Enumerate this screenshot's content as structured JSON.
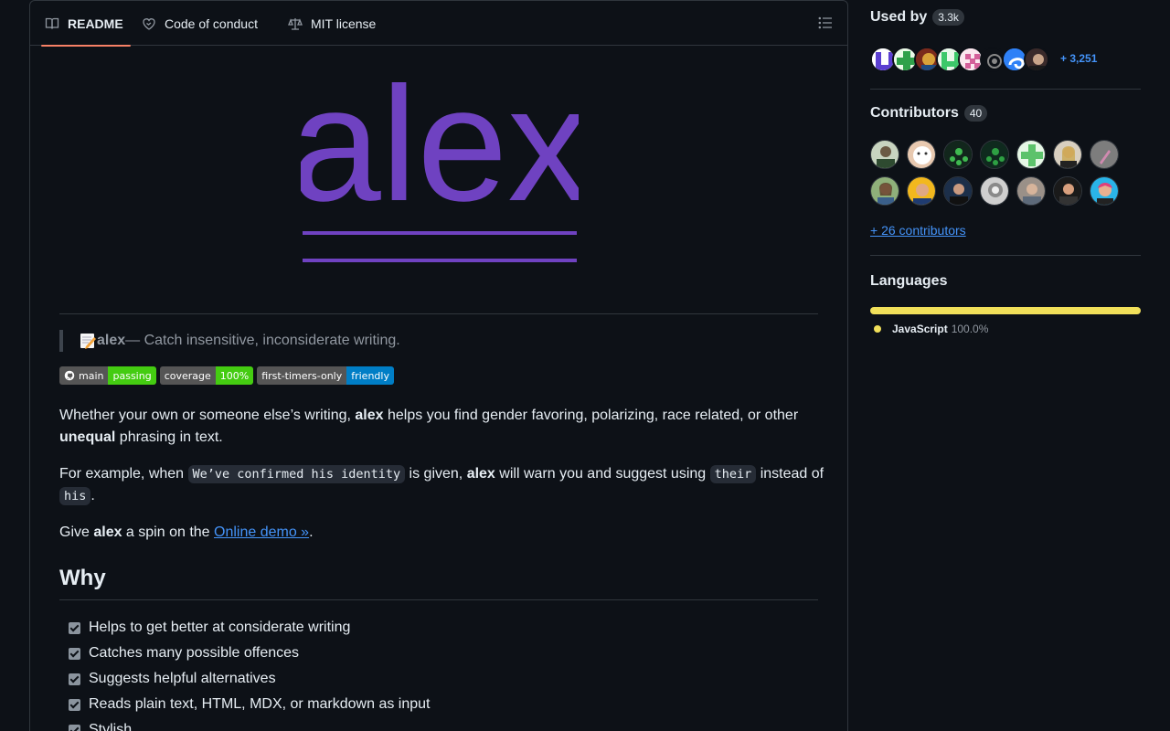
{
  "tabs": {
    "readme": "README",
    "conduct": "Code of conduct",
    "license": "MIT license"
  },
  "logo": {
    "text": "alex",
    "color": "#6f42c1"
  },
  "tagline": {
    "name": "alex",
    "rest": " — Catch insensitive, inconsiderate writing."
  },
  "badges": [
    {
      "left": "main",
      "right": "passing"
    },
    {
      "left": "coverage",
      "right": "100%"
    },
    {
      "left": "first-timers-only",
      "right": "friendly"
    }
  ],
  "intro": {
    "a": "Whether your own or someone else’s writing, ",
    "b": "alex",
    "c": " helps you find gender favoring, polarizing, race related, or other ",
    "d": "unequal",
    "e": " phrasing in text."
  },
  "example": {
    "a": "For example, when ",
    "code1": "We’ve confirmed his identity",
    "b": " is given, ",
    "bold": "alex",
    "c": " will warn you and suggest using ",
    "code2": "their",
    "d": " instead of ",
    "code3": "his",
    "e": "."
  },
  "demo": {
    "a": "Give ",
    "bold": "alex",
    "b": " a spin on the ",
    "link": "Online demo »",
    "c": "."
  },
  "why": {
    "heading": "Why",
    "items": [
      "Helps to get better at considerate writing",
      "Catches many possible offences",
      "Suggests helpful alternatives",
      "Reads plain text, HTML, MDX, or markdown as input",
      "Stylish"
    ]
  },
  "sidebar": {
    "used_by": {
      "title": "Used by",
      "count": "3.3k",
      "more": "+ 3,251"
    },
    "contributors": {
      "title": "Contributors",
      "count": "40",
      "more": "+ 26 contributors"
    },
    "languages": {
      "title": "Languages",
      "items": [
        {
          "name": "JavaScript",
          "percent": "100.0%",
          "fraction": 1.0,
          "color": "#f1e05a"
        }
      ]
    }
  }
}
